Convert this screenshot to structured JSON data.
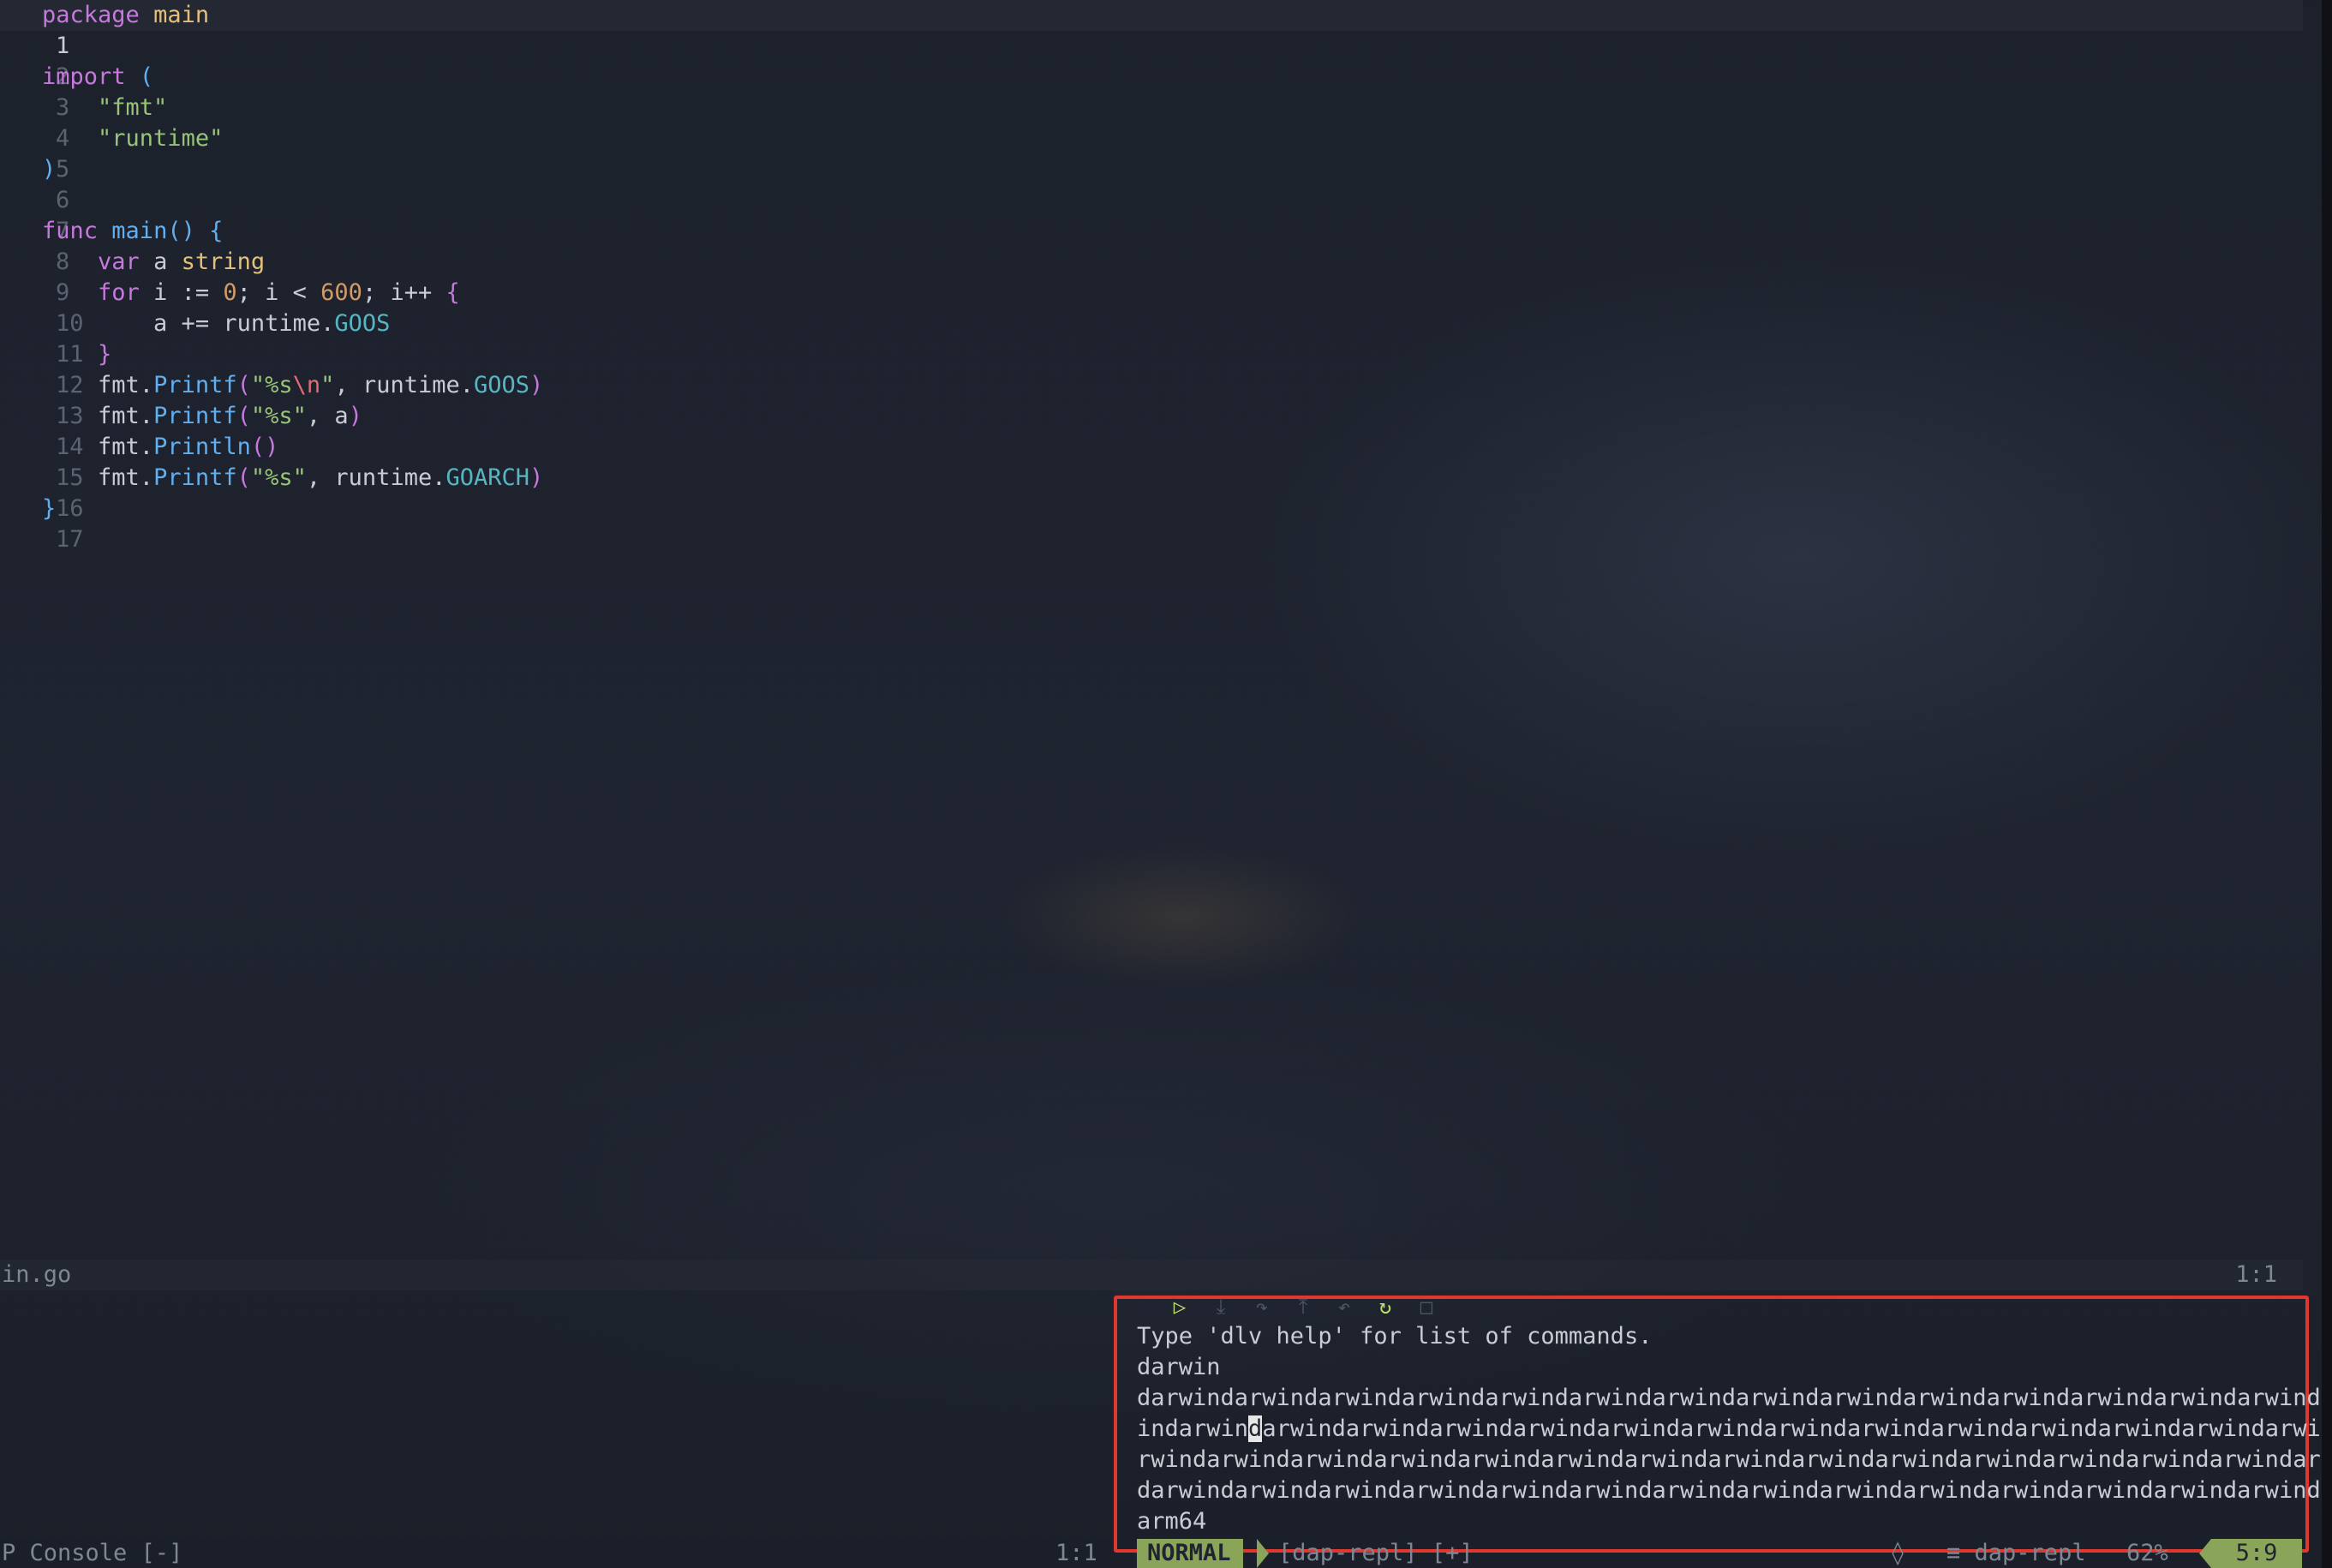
{
  "editor": {
    "lines": [
      {
        "n": "1",
        "current": true
      },
      {
        "n": "2"
      },
      {
        "n": "3"
      },
      {
        "n": "4"
      },
      {
        "n": "5"
      },
      {
        "n": "6"
      },
      {
        "n": "7"
      },
      {
        "n": "8"
      },
      {
        "n": "9"
      },
      {
        "n": "10"
      },
      {
        "n": "11"
      },
      {
        "n": "12"
      },
      {
        "n": "13"
      },
      {
        "n": "14"
      },
      {
        "n": "15"
      },
      {
        "n": "16"
      },
      {
        "n": "17"
      }
    ],
    "code": {
      "l1_kw": "package",
      "l1_name": "main",
      "l3_kw": "import",
      "l3_paren": "(",
      "l4_str": "\"fmt\"",
      "l5_str": "\"runtime\"",
      "l6_paren": ")",
      "l8_kw": "func",
      "l8_fn": "main",
      "l8_parens": "()",
      "l8_brace": "{",
      "l9_kw": "var",
      "l9_id": "a",
      "l9_type": "string",
      "l10_kw": "for",
      "l10_mid1": "i := ",
      "l10_num1": "0",
      "l10_mid2": "; i < ",
      "l10_num2": "600",
      "l10_mid3": "; i++ ",
      "l10_brace": "{",
      "l11_pre": "a += runtime.",
      "l11_prop": "GOOS",
      "l12_brace": "}",
      "l13_pkg": "fmt.",
      "l13_fn": "Printf",
      "l13_p1": "(",
      "l13_str1": "\"%s",
      "l13_esc": "\\n",
      "l13_str2": "\"",
      "l13_mid": ", runtime.",
      "l13_prop": "GOOS",
      "l13_p2": ")",
      "l14_pkg": "fmt.",
      "l14_fn": "Printf",
      "l14_p1": "(",
      "l14_str": "\"%s\"",
      "l14_mid": ", a",
      "l14_p2": ")",
      "l15_pkg": "fmt.",
      "l15_fn": "Println",
      "l15_p": "()",
      "l16_pkg": "fmt.",
      "l16_fn": "Printf",
      "l16_p1": "(",
      "l16_str": "\"%s\"",
      "l16_mid": ", runtime.",
      "l16_prop": "GOARCH",
      "l16_p2": ")",
      "l17_brace": "}"
    }
  },
  "top_status": {
    "file": "in.go",
    "position": "1:1"
  },
  "console": {
    "label": "P Console [-]",
    "position": "1:1"
  },
  "dap_toolbar": {
    "icons": [
      "play-icon",
      "step-into-icon",
      "step-over-icon",
      "step-out-icon",
      "step-back-icon",
      "restart-icon",
      "stop-icon"
    ],
    "glyphs": [
      "▷",
      "⤓",
      "↷",
      "⤒",
      "↶",
      "↻",
      "□"
    ]
  },
  "repl": {
    "line1": "Type 'dlv help' for list of commands.",
    "line2": "darwin",
    "line3": "darwindarwindarwindarwindarwindarwindarwindarwindarwindarwindarwindarwindarwindarwindarwind",
    "line4_pre": "indarwin",
    "line4_cursor": "d",
    "line4_post": "arwindarwindarwindarwindarwindarwindarwindarwindarwindarwindarwindarwindarwindarwi",
    "line5": "rwindarwindarwindarwindarwindarwindarwindarwindarwindarwindarwindarwindarwindarwindar",
    "line6": "darwindarwindarwindarwindarwindarwindarwindarwindarwindarwindarwindarwindarwindarwind",
    "line7": "arm64"
  },
  "repl_status": {
    "mode": "NORMAL",
    "buffer": "[dap-repl] [+]",
    "icon": "◊",
    "filetype_icon": "≡",
    "filetype": "dap-repl",
    "percent": "62%",
    "position": "5:9"
  },
  "colors": {
    "accent_green": "#8aa55a",
    "highlight_border": "#e0382f",
    "keyword": "#c678dd",
    "string": "#98c379",
    "number": "#d19a66",
    "function": "#61afef",
    "property": "#56b6c2"
  }
}
